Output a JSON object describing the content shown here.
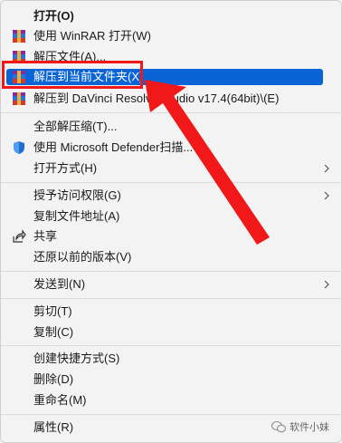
{
  "menu": {
    "items": [
      {
        "label": "打开(O)",
        "icon": "",
        "chev": false
      },
      {
        "label": "使用 WinRAR 打开(W)",
        "icon": "winrar-icon",
        "chev": false
      },
      {
        "label": "解压文件(A)...",
        "icon": "winrar-icon",
        "chev": false
      },
      {
        "label": "解压到当前文件夹(X)",
        "icon": "winrar-icon",
        "chev": false
      },
      {
        "label": "解压到 DaVinci Resolve Studio v17.4(64bit)\\(E)",
        "icon": "winrar-icon",
        "chev": false
      },
      {
        "label": "全部解压缩(T)...",
        "icon": "",
        "chev": false
      },
      {
        "label": "使用 Microsoft Defender扫描...",
        "icon": "defender-shield-icon",
        "chev": false
      },
      {
        "label": "打开方式(H)",
        "icon": "",
        "chev": true
      },
      {
        "label": "授予访问权限(G)",
        "icon": "",
        "chev": true
      },
      {
        "label": "复制文件地址(A)",
        "icon": "",
        "chev": false
      },
      {
        "label": "共享",
        "icon": "share-icon",
        "chev": false
      },
      {
        "label": "还原以前的版本(V)",
        "icon": "",
        "chev": false
      },
      {
        "label": "发送到(N)",
        "icon": "",
        "chev": true
      },
      {
        "label": "剪切(T)",
        "icon": "",
        "chev": false
      },
      {
        "label": "复制(C)",
        "icon": "",
        "chev": false
      },
      {
        "label": "创建快捷方式(S)",
        "icon": "",
        "chev": false
      },
      {
        "label": "删除(D)",
        "icon": "",
        "chev": false
      },
      {
        "label": "重命名(M)",
        "icon": "",
        "chev": false
      },
      {
        "label": "属性(R)",
        "icon": "",
        "chev": false
      }
    ]
  },
  "watermark": {
    "text": "软件小妹"
  },
  "colors": {
    "highlight": "#0a64d6",
    "annotation": "#f01818"
  }
}
